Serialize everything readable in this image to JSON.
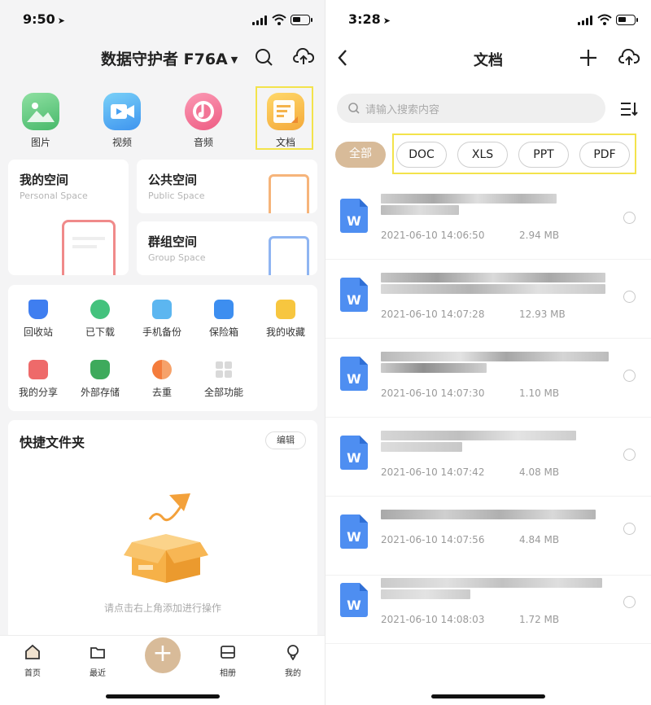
{
  "left": {
    "status": {
      "time": "9:50"
    },
    "header": {
      "title": "数据守护者 F76A"
    },
    "categories": [
      {
        "label": "图片",
        "icon": "image-icon"
      },
      {
        "label": "视频",
        "icon": "video-icon"
      },
      {
        "label": "音频",
        "icon": "music-icon"
      },
      {
        "label": "文档",
        "icon": "document-icon"
      }
    ],
    "spaces": {
      "personal": {
        "title": "我的空间",
        "subtitle": "Personal Space"
      },
      "public": {
        "title": "公共空间",
        "subtitle": "Public Space"
      },
      "group": {
        "title": "群组空间",
        "subtitle": "Group Space"
      }
    },
    "tools": [
      {
        "label": "回收站",
        "icon": "recycle-bin-icon"
      },
      {
        "label": "已下载",
        "icon": "downloaded-icon"
      },
      {
        "label": "手机备份",
        "icon": "phone-backup-icon"
      },
      {
        "label": "保险箱",
        "icon": "safe-icon"
      },
      {
        "label": "我的收藏",
        "icon": "favorites-icon"
      },
      {
        "label": "我的分享",
        "icon": "share-icon"
      },
      {
        "label": "外部存储",
        "icon": "external-storage-icon"
      },
      {
        "label": "去重",
        "icon": "dedupe-icon"
      },
      {
        "label": "全部功能",
        "icon": "all-functions-icon"
      }
    ],
    "quick": {
      "title": "快捷文件夹",
      "edit": "编辑",
      "empty_hint": "请点击右上角添加进行操作"
    },
    "tabbar": [
      {
        "label": "首页",
        "icon": "home-icon"
      },
      {
        "label": "最近",
        "icon": "recent-icon"
      },
      {
        "label": "相册",
        "icon": "album-icon"
      },
      {
        "label": "我的",
        "icon": "profile-icon"
      }
    ],
    "fab_label": "+"
  },
  "right": {
    "status": {
      "time": "3:28"
    },
    "header": {
      "title": "文档"
    },
    "search": {
      "placeholder": "请输入搜索内容"
    },
    "filters": [
      "全部",
      "DOC",
      "XLS",
      "PPT",
      "PDF"
    ],
    "file_icon_letter": "W",
    "files": [
      {
        "date": "2021-06-10 14:06:50",
        "size": "2.94 MB"
      },
      {
        "date": "2021-06-10 14:07:28",
        "size": "12.93 MB"
      },
      {
        "date": "2021-06-10 14:07:30",
        "size": "1.10 MB"
      },
      {
        "date": "2021-06-10 14:07:42",
        "size": "4.08 MB"
      },
      {
        "date": "2021-06-10 14:07:56",
        "size": "4.84 MB"
      },
      {
        "date": "2021-06-10 14:08:03",
        "size": "1.72 MB"
      }
    ]
  },
  "colors": {
    "accent": "#d8bb99",
    "highlight": "#f3e34b",
    "doc_blue": "#4e8ef1"
  }
}
